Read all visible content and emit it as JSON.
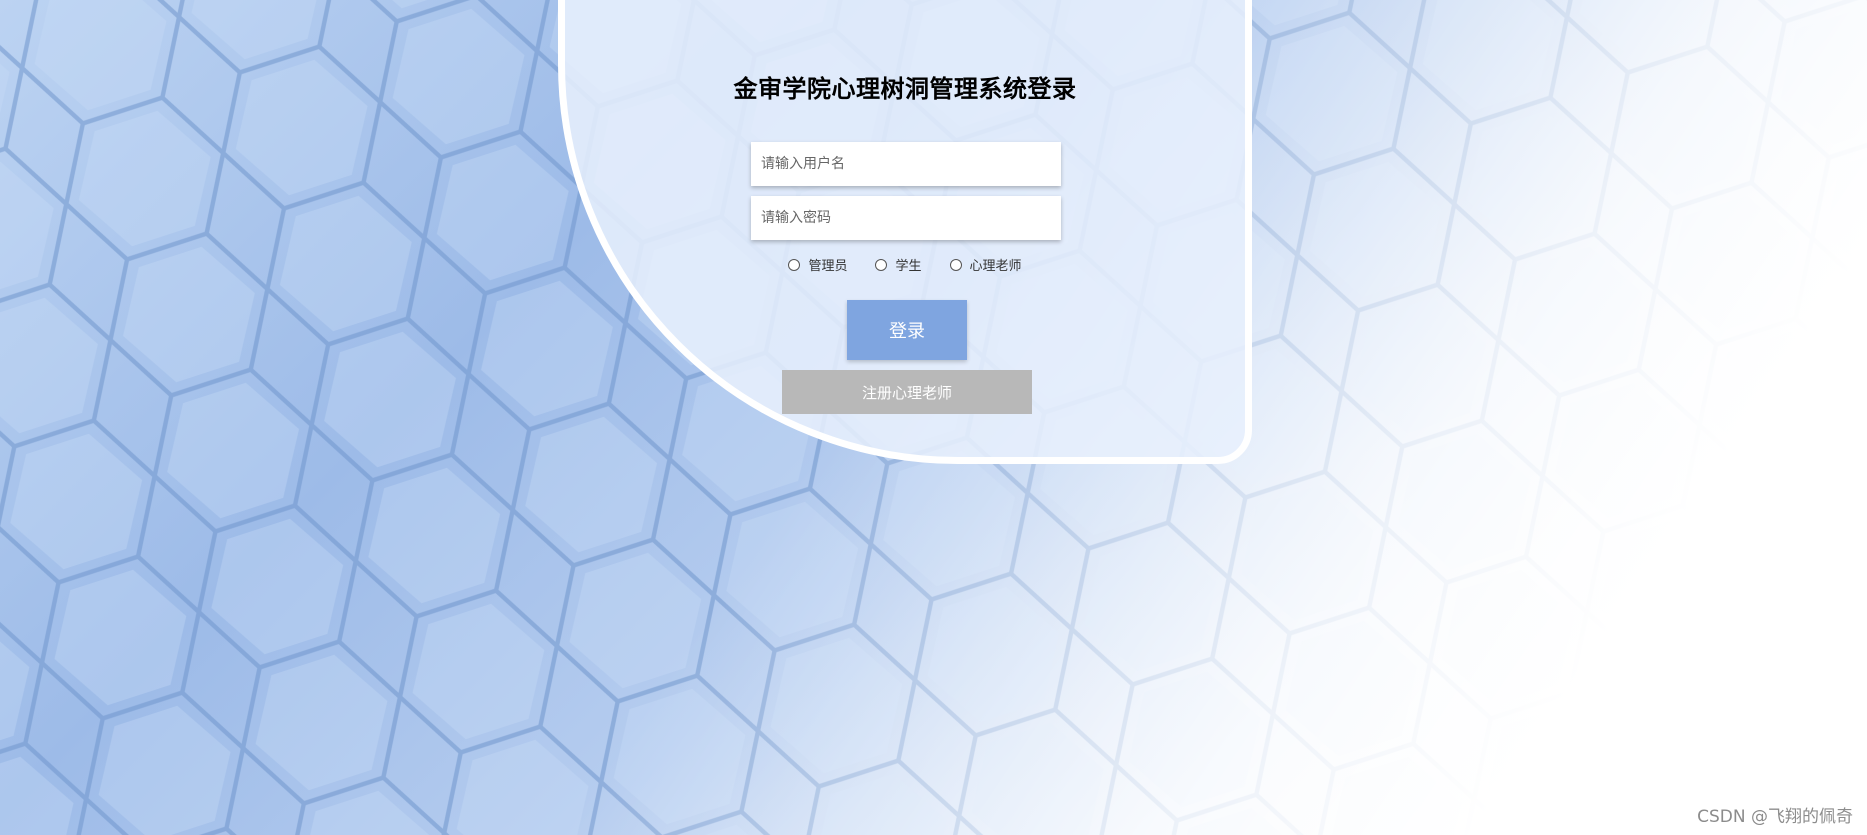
{
  "login": {
    "title": "金审学院心理树洞管理系统登录",
    "username_placeholder": "请输入用户名",
    "password_placeholder": "请输入密码",
    "roles": [
      "管理员",
      "学生",
      "心理老师"
    ],
    "login_label": "登录",
    "register_label": "注册心理老师"
  },
  "watermark": "CSDN @飞翔的佩奇",
  "colors": {
    "login_button": "#7fa5e0",
    "register_button": "#b8b8b8",
    "card_border": "#ffffff"
  }
}
